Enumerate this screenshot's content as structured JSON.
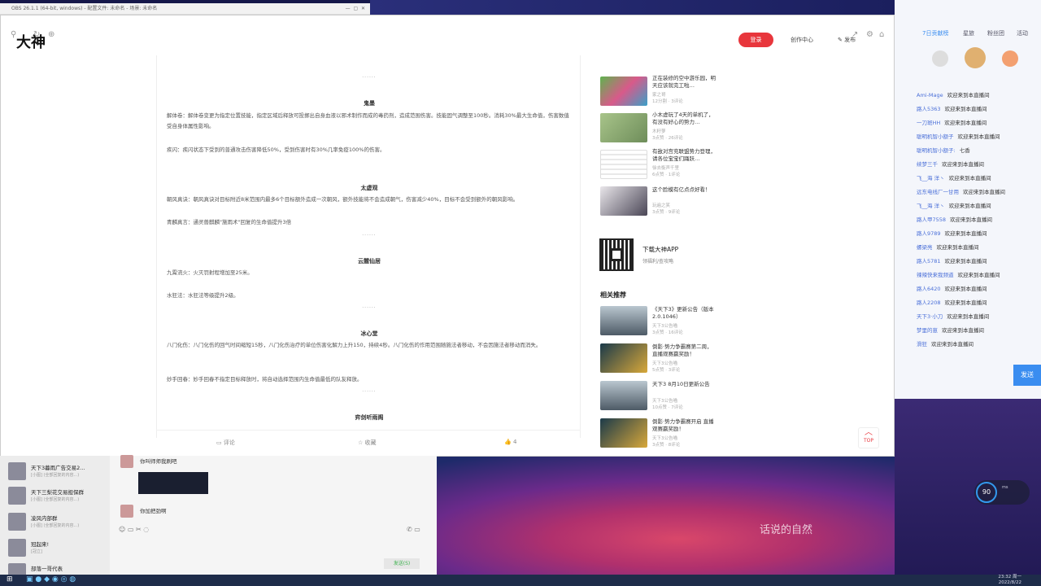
{
  "obs": {
    "title": "OBS 26.1.1 (64-bit, windows) - 配置文件: 未命名 - 场景: 未命名"
  },
  "header": {
    "logo": "大神",
    "login": "登录",
    "creator": "创作中心",
    "publish": "发布"
  },
  "article": {
    "sep": "······",
    "sections": [
      {
        "title": "鬼墨",
        "paras": [
          "解体卷：解体卷变更为指定位置技能，指定区域后释放可投掷出自身血液以邪术制作而成的毒药剂，造成范围伤害。技能固气调整至100秒。消耗30%最大生命值，伤害数值受自身体属性影响。",
          "疾闪：疾闪状态下受到的普通攻击伤害降低50%，受到伤害时有30%几率免疫100%的伤害。"
        ]
      },
      {
        "title": "太虚观",
        "paras": [
          "朝风真诀：朝风真诀对目标附近8米范围内最多6个目标额外造成一次朝风，额外技能将不会造成朝气，伤害减少40%，目标不会受到额外的朝风影响。",
          "青麟真言：通灵兽麒麟\"施雨术\"回复的生命值提升3倍"
        ]
      },
      {
        "title": "云麓仙居",
        "paras": [
          "九霄流火：火灭罚射程增加至25米。",
          "水狂法：水狂法等级提升2级。"
        ]
      },
      {
        "title": "冰心堂",
        "paras": [
          "八门化伤：八门化伤的回气时间缩短15秒，八门化伤治疗的单位伤害化解力上升150，持续4秒。八门化伤的作用范围随施法者移动，不会因施法者移动而消失。",
          "妙手回春：妙手回春不指定目标释放时，将自动选择范围内生命值最低的队友释放。"
        ]
      },
      {
        "title": "弈剑听雨阁",
        "paras": []
      }
    ],
    "actions": {
      "comment": "评论",
      "favorite": "收藏",
      "like": "4"
    }
  },
  "sidebar": {
    "hot": [
      {
        "title": "正在装修的空中游乐园，明天应该就完工啦…",
        "author": "家之哥",
        "meta": "12分割 · 3评论"
      },
      {
        "title": "小木虚玩了4天的单机了，有没有好心的势力…",
        "author": "木籽萝",
        "meta": "3点赞 · 26评论"
      },
      {
        "title": "有敌对宫充联盟势力登理，请各位宝宝们踊跃…",
        "author": "徐去衡声千里",
        "meta": "6点赞 · 1评论"
      },
      {
        "title": "这个脸模有亿点点好看！",
        "author": "玩遍之笑",
        "meta": "3点赞 · 9评论"
      }
    ],
    "app": {
      "title": "下载大神APP",
      "sub": "领福利/查攻略"
    },
    "related_title": "相关推荐",
    "related": [
      {
        "title": "《天下3》更新公告（版本2.0.1046）",
        "author": "天下3公告喵",
        "meta": "3点赞 · 16评论"
      },
      {
        "title": "倒影·势力争霸赛第二周，直播观赛赢奖励！",
        "author": "天下3公告喵",
        "meta": "5点赞 · 3评论"
      },
      {
        "title": "天下3 8月10日更新公告",
        "author": "天下3公告喵",
        "meta": "10点赞 · 7评论"
      },
      {
        "title": "倒影·势力争霸赛开启 直播观赛赢奖励！",
        "author": "天下3公告喵",
        "meta": "3点赞 · 8评论"
      }
    ],
    "top": "TOP"
  },
  "live": {
    "tabs": [
      "7日贡献榜",
      "星旅",
      "粉丝团",
      "活动"
    ],
    "chat": [
      {
        "u": "Ami-Mage",
        "m": "欢迎来到本直播间"
      },
      {
        "u": "路人5363",
        "m": "欢迎来到本直播间"
      },
      {
        "u": "一刀斑HH",
        "m": "欢迎来到本直播间"
      },
      {
        "u": "聪明机智小额子",
        "m": "欢迎来到本直播间"
      },
      {
        "u": "聪明机智小额子:",
        "m": "七香"
      },
      {
        "u": "续梦三千",
        "m": "欢迎来到本直播间"
      },
      {
        "u": "飞__海 洋丶",
        "m": "欢迎来到本直播间"
      },
      {
        "u": "远东电线厂一甘用",
        "m": "欢迎来到本直播间"
      },
      {
        "u": "飞__海 洋丶",
        "m": "欢迎来到本直播间"
      },
      {
        "u": "路人甲7558",
        "m": "欢迎来到本直播间"
      },
      {
        "u": "路人9789",
        "m": "欢迎来到本直播间"
      },
      {
        "u": "螺梁亮",
        "m": "欢迎来到本直播间"
      },
      {
        "u": "路人5781",
        "m": "欢迎来到本直播间"
      },
      {
        "u": "辣辣快来我频道",
        "m": "欢迎来到本直播间"
      },
      {
        "u": "路人6420",
        "m": "欢迎来到本直播间"
      },
      {
        "u": "路人2208",
        "m": "欢迎来到本直播间"
      },
      {
        "u": "天下3·小刀",
        "m": "欢迎来到本直播间"
      },
      {
        "u": "梦里的崽",
        "m": "欢迎来到本直播间"
      },
      {
        "u": "滑狂",
        "m": "欢迎来到本直播间"
      }
    ],
    "send": "发送"
  },
  "im": {
    "convs": [
      {
        "n": "天下3暮雨广告交易2...",
        "p": "[小图] (全部回复的内容...)"
      },
      {
        "n": "天下三梨花交易担保群",
        "p": "[小图] (全部回复的内容...)"
      },
      {
        "n": "凌风内部群",
        "p": "[小图] (全部回复的内容...)"
      },
      {
        "n": "冠起来!",
        "p": "[冠立]"
      },
      {
        "n": "部落一哥代表",
        "p": ""
      }
    ],
    "messages": [
      "你叫师师我刷吧",
      "你加把劲啊"
    ],
    "send": "发送(S)"
  },
  "overlay": {
    "watermark": "话说的自然",
    "fps": "90",
    "fps_label": "ms"
  },
  "clock": {
    "time": "23:32 周一",
    "date": "2022/8/22"
  }
}
